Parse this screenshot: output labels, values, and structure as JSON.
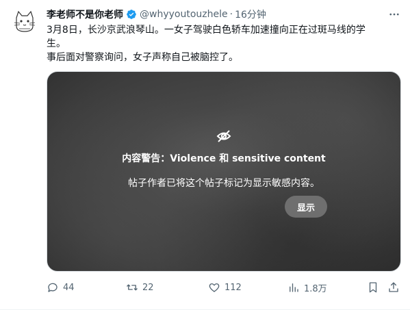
{
  "author": {
    "name": "李老师不是你老师",
    "handle": "@whyyoutouzhele",
    "separator": "·",
    "time": "16分钟"
  },
  "tweet": {
    "line1": "3月8日，长沙京武浪琴山。一女子驾驶白色轿车加速撞向正在过斑马线的学",
    "line2": "生。",
    "line3": "事后面对警察询问，女子声称自己被脑控了。"
  },
  "media": {
    "warning_title": "内容警告：Violence 和 sensitive content",
    "warning_subtitle": "帖子作者已将这个帖子标记为显示敏感内容。",
    "show_label": "显示"
  },
  "actions": {
    "replies": "44",
    "reposts": "22",
    "likes": "112",
    "views": "1.8万"
  },
  "colors": {
    "verified": "#1d9bf0",
    "secondary_text": "#536471"
  }
}
